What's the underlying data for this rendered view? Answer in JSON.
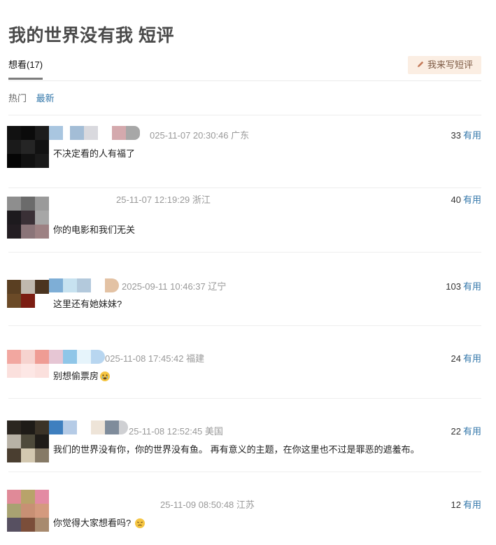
{
  "page": {
    "title": "我的世界没有我 短评"
  },
  "tabs": {
    "active_label": "想看(17)"
  },
  "actions": {
    "write_label": "我来写短评"
  },
  "sort": {
    "hot": "热门",
    "latest": "最新"
  },
  "comments": [
    {
      "meta": "025-11-07 20:30:46 广东",
      "votes": "33",
      "vote_label": "有用",
      "text": "不决定看的人有福了"
    },
    {
      "meta": "25-11-07 12:19:29 浙江",
      "votes": "40",
      "vote_label": "有用",
      "text": "你的电影和我们无关"
    },
    {
      "meta": "2025-09-11 10:46:37 辽宁",
      "votes": "103",
      "vote_label": "有用",
      "text": "这里还有她妹妹?"
    },
    {
      "meta": "025-11-08 17:45:42 福建",
      "votes": "24",
      "vote_label": "有用",
      "text": "别想偷票房"
    },
    {
      "meta": "25-11-08 12:52:45 美国",
      "votes": "22",
      "vote_label": "有用",
      "text": "我们的世界没有你，你的世界没有鱼。 再有意义的主题，在你这里也不过是罪恶的遮羞布。"
    },
    {
      "meta": "25-11-09 08:50:48 江苏",
      "votes": "12",
      "vote_label": "有用",
      "text": "你觉得大家想看吗?"
    }
  ],
  "icons": {
    "write": "pencil-icon",
    "emoji_4": "emoji-crying-icon",
    "emoji_6": "emoji-sad-icon"
  },
  "colors": {
    "link": "#3377aa",
    "write_bg": "#fbeee3",
    "meta": "#999999"
  }
}
